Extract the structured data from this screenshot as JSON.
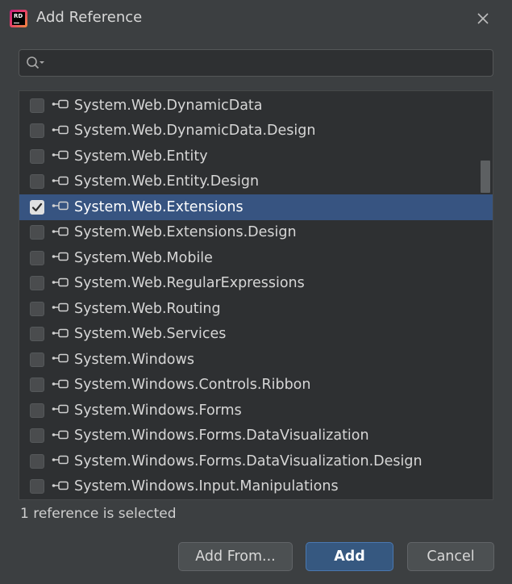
{
  "window": {
    "title": "Add Reference",
    "app_icon": "rider-logo",
    "app_icon_text": "RD"
  },
  "search": {
    "value": "",
    "placeholder": ""
  },
  "references": [
    {
      "label": "System.Web.DynamicData",
      "checked": false
    },
    {
      "label": "System.Web.DynamicData.Design",
      "checked": false
    },
    {
      "label": "System.Web.Entity",
      "checked": false
    },
    {
      "label": "System.Web.Entity.Design",
      "checked": false
    },
    {
      "label": "System.Web.Extensions",
      "checked": true
    },
    {
      "label": "System.Web.Extensions.Design",
      "checked": false
    },
    {
      "label": "System.Web.Mobile",
      "checked": false
    },
    {
      "label": "System.Web.RegularExpressions",
      "checked": false
    },
    {
      "label": "System.Web.Routing",
      "checked": false
    },
    {
      "label": "System.Web.Services",
      "checked": false
    },
    {
      "label": "System.Windows",
      "checked": false
    },
    {
      "label": "System.Windows.Controls.Ribbon",
      "checked": false
    },
    {
      "label": "System.Windows.Forms",
      "checked": false
    },
    {
      "label": "System.Windows.Forms.DataVisualization",
      "checked": false
    },
    {
      "label": "System.Windows.Forms.DataVisualization.Design",
      "checked": false
    },
    {
      "label": "System.Windows.Input.Manipulations",
      "checked": false
    }
  ],
  "status_text": "1 reference is selected",
  "buttons": {
    "add_from": "Add From...",
    "add": "Add",
    "cancel": "Cancel"
  },
  "colors": {
    "background": "#3c3f41",
    "list_bg": "#2e3032",
    "selection": "#375481",
    "primary_button": "#365880"
  }
}
